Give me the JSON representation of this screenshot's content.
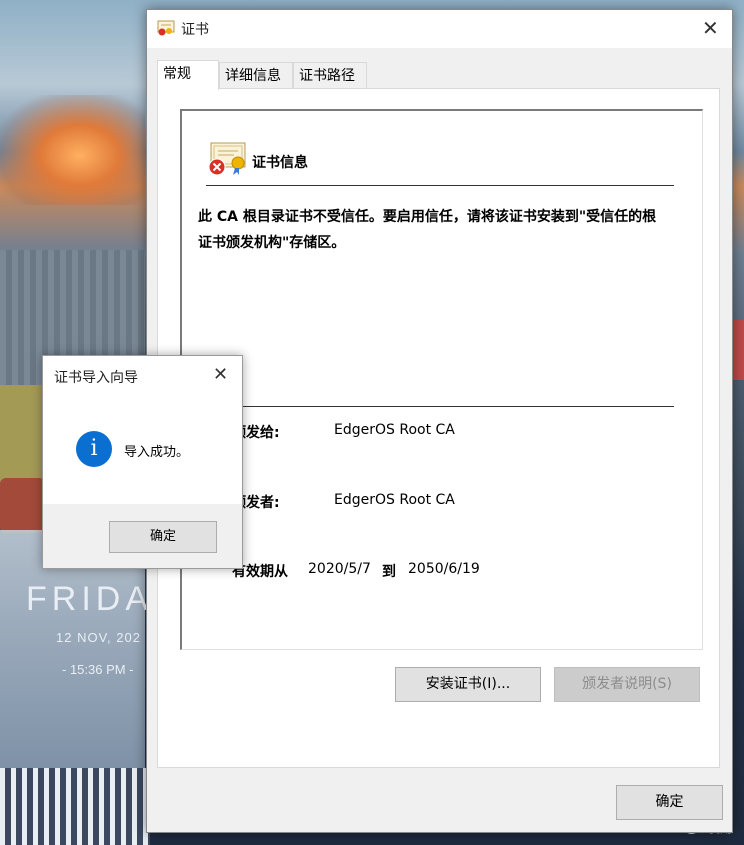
{
  "wallpaper": {
    "day": "FRIDA",
    "date": "12 NOV, 202",
    "time": "- 15:36 PM -",
    "watermark": "CSDN @海拥 "
  },
  "cert_window": {
    "title": "证书",
    "tabs": [
      "常规",
      "详细信息",
      "证书路径"
    ],
    "active_tab": "常规",
    "section_title": "证书信息",
    "warning": "此 CA 根目录证书不受信任。要启用信任，请将该证书安装到\"受信任的根证书颁发机构\"存储区。",
    "fields": {
      "issued_to_label": "颁发给:",
      "issued_to_value": "EdgerOS Root CA",
      "issued_by_label": "颁发者:",
      "issued_by_value": "EdgerOS Root CA",
      "valid_label": "有效期从",
      "valid_from": "2020/5/7",
      "valid_to_word": "到",
      "valid_to": "2050/6/19"
    },
    "buttons": {
      "install": "安装证书(I)...",
      "issuer_statement": "颁发者说明(S)",
      "ok": "确定"
    }
  },
  "wizard": {
    "title": "证书导入向导",
    "message": "导入成功。",
    "ok": "确定",
    "icon": "info-icon"
  },
  "colors": {
    "accent_info": "#0b6fd1",
    "window_bg": "#f0f0f0"
  }
}
